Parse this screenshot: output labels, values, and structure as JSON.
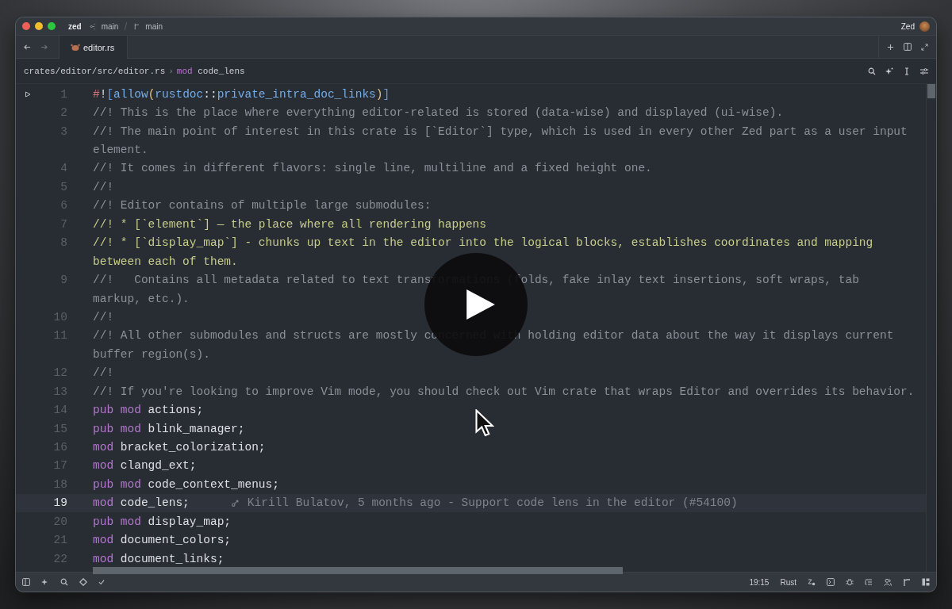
{
  "title_bar": {
    "project": "zed",
    "branch": "main",
    "branch_2": "main",
    "user": "Zed"
  },
  "tabs": [
    {
      "label": "editor.rs",
      "selected": true
    }
  ],
  "breadcrumb": {
    "path": "crates/editor/src/editor.rs",
    "separator": "›",
    "keyword": "mod",
    "symbol": "code_lens"
  },
  "lines": [
    {
      "number": "1",
      "current": false,
      "run": true,
      "rows": [
        [
          {
            "text": "#",
            "kind": "punct"
          },
          {
            "text": "!",
            "kind": "plain"
          },
          {
            "text": "[",
            "kind": "bracket"
          },
          {
            "text": "allow",
            "kind": "ident"
          },
          {
            "text": "(",
            "kind": "paren"
          },
          {
            "text": "rustdoc",
            "kind": "ident"
          },
          {
            "text": "::",
            "kind": "plain"
          },
          {
            "text": "private_intra_doc_links",
            "kind": "ident"
          },
          {
            "text": ")",
            "kind": "paren"
          },
          {
            "text": "]",
            "kind": "bracket"
          }
        ]
      ]
    },
    {
      "number": "2",
      "current": false,
      "run": false,
      "rows": [
        [
          {
            "text": "//! This is the place where everything editor-related is stored (data-wise) and displayed (ui-wise).",
            "kind": "comment"
          }
        ]
      ]
    },
    {
      "number": "3",
      "current": false,
      "run": false,
      "rows": [
        [
          {
            "text": "//! The main point of interest in this crate is [`Editor`] type, which is used in every other Zed part as a user input",
            "kind": "comment"
          }
        ],
        [
          {
            "text": "element.",
            "kind": "comment"
          }
        ]
      ]
    },
    {
      "number": "4",
      "current": false,
      "run": false,
      "rows": [
        [
          {
            "text": "//! It comes in different flavors: single line, multiline and a fixed height one.",
            "kind": "comment"
          }
        ]
      ]
    },
    {
      "number": "5",
      "current": false,
      "run": false,
      "rows": [
        [
          {
            "text": "//!",
            "kind": "comment"
          }
        ]
      ]
    },
    {
      "number": "6",
      "current": false,
      "run": false,
      "rows": [
        [
          {
            "text": "//! Editor contains of multiple large submodules:",
            "kind": "comment"
          }
        ]
      ]
    },
    {
      "number": "7",
      "current": false,
      "run": false,
      "rows": [
        [
          {
            "text": "//! * [`element`] — the place where all rendering happens",
            "kind": "doc"
          }
        ]
      ]
    },
    {
      "number": "8",
      "current": false,
      "run": false,
      "rows": [
        [
          {
            "text": "//! * [`display_map`] - chunks up text in the editor into the logical blocks, establishes coordinates and mapping",
            "kind": "doc"
          }
        ],
        [
          {
            "text": "between each of them.",
            "kind": "doc"
          }
        ]
      ]
    },
    {
      "number": "9",
      "current": false,
      "run": false,
      "rows": [
        [
          {
            "text": "//!   Contains all metadata related to text transformations (folds, fake inlay text insertions, soft wraps, tab",
            "kind": "comment"
          }
        ],
        [
          {
            "text": "markup, etc.).",
            "kind": "comment"
          }
        ]
      ]
    },
    {
      "number": "10",
      "current": false,
      "run": false,
      "rows": [
        [
          {
            "text": "//!",
            "kind": "comment"
          }
        ]
      ]
    },
    {
      "number": "11",
      "current": false,
      "run": false,
      "rows": [
        [
          {
            "text": "//! All other submodules and structs are mostly concerned with holding editor data about the way it displays current",
            "kind": "comment"
          }
        ],
        [
          {
            "text": "buffer region(s).",
            "kind": "comment"
          }
        ]
      ]
    },
    {
      "number": "12",
      "current": false,
      "run": false,
      "rows": [
        [
          {
            "text": "//!",
            "kind": "comment"
          }
        ]
      ]
    },
    {
      "number": "13",
      "current": false,
      "run": false,
      "rows": [
        [
          {
            "text": "//! If you're looking to improve Vim mode, you should check out Vim crate that wraps Editor and overrides its behavior.",
            "kind": "comment"
          }
        ]
      ]
    },
    {
      "number": "14",
      "current": false,
      "run": false,
      "rows": [
        [
          {
            "text": "pub",
            "kind": "keyword"
          },
          {
            "text": " ",
            "kind": "plain"
          },
          {
            "text": "mod",
            "kind": "keyword"
          },
          {
            "text": " actions;",
            "kind": "plain"
          }
        ]
      ]
    },
    {
      "number": "15",
      "current": false,
      "run": false,
      "rows": [
        [
          {
            "text": "pub",
            "kind": "keyword"
          },
          {
            "text": " ",
            "kind": "plain"
          },
          {
            "text": "mod",
            "kind": "keyword"
          },
          {
            "text": " blink_manager;",
            "kind": "plain"
          }
        ]
      ]
    },
    {
      "number": "16",
      "current": false,
      "run": false,
      "rows": [
        [
          {
            "text": "mod",
            "kind": "keyword"
          },
          {
            "text": " bracket_colorization;",
            "kind": "plain"
          }
        ]
      ]
    },
    {
      "number": "17",
      "current": false,
      "run": false,
      "rows": [
        [
          {
            "text": "mod",
            "kind": "keyword"
          },
          {
            "text": " clangd_ext;",
            "kind": "plain"
          }
        ]
      ]
    },
    {
      "number": "18",
      "current": false,
      "run": false,
      "rows": [
        [
          {
            "text": "pub",
            "kind": "keyword"
          },
          {
            "text": " ",
            "kind": "plain"
          },
          {
            "text": "mod",
            "kind": "keyword"
          },
          {
            "text": " code_context_menus;",
            "kind": "plain"
          }
        ]
      ]
    },
    {
      "number": "19",
      "current": true,
      "run": false,
      "blame": "Kirill Bulatov, 5 months ago - Support code lens in the editor (#54100)",
      "rows": [
        [
          {
            "text": "mod",
            "kind": "keyword"
          },
          {
            "text": " code_lens;",
            "kind": "plain"
          }
        ]
      ]
    },
    {
      "number": "20",
      "current": false,
      "run": false,
      "rows": [
        [
          {
            "text": "pub",
            "kind": "keyword"
          },
          {
            "text": " ",
            "kind": "plain"
          },
          {
            "text": "mod",
            "kind": "keyword"
          },
          {
            "text": " display_map;",
            "kind": "plain"
          }
        ]
      ]
    },
    {
      "number": "21",
      "current": false,
      "run": false,
      "rows": [
        [
          {
            "text": "mod",
            "kind": "keyword"
          },
          {
            "text": " document_colors;",
            "kind": "plain"
          }
        ]
      ]
    },
    {
      "number": "22",
      "current": false,
      "run": false,
      "rows": [
        [
          {
            "text": "mod",
            "kind": "keyword"
          },
          {
            "text": " document_links;",
            "kind": "plain"
          }
        ]
      ]
    }
  ],
  "status_bar": {
    "position": "19:15",
    "language": "Rust"
  }
}
